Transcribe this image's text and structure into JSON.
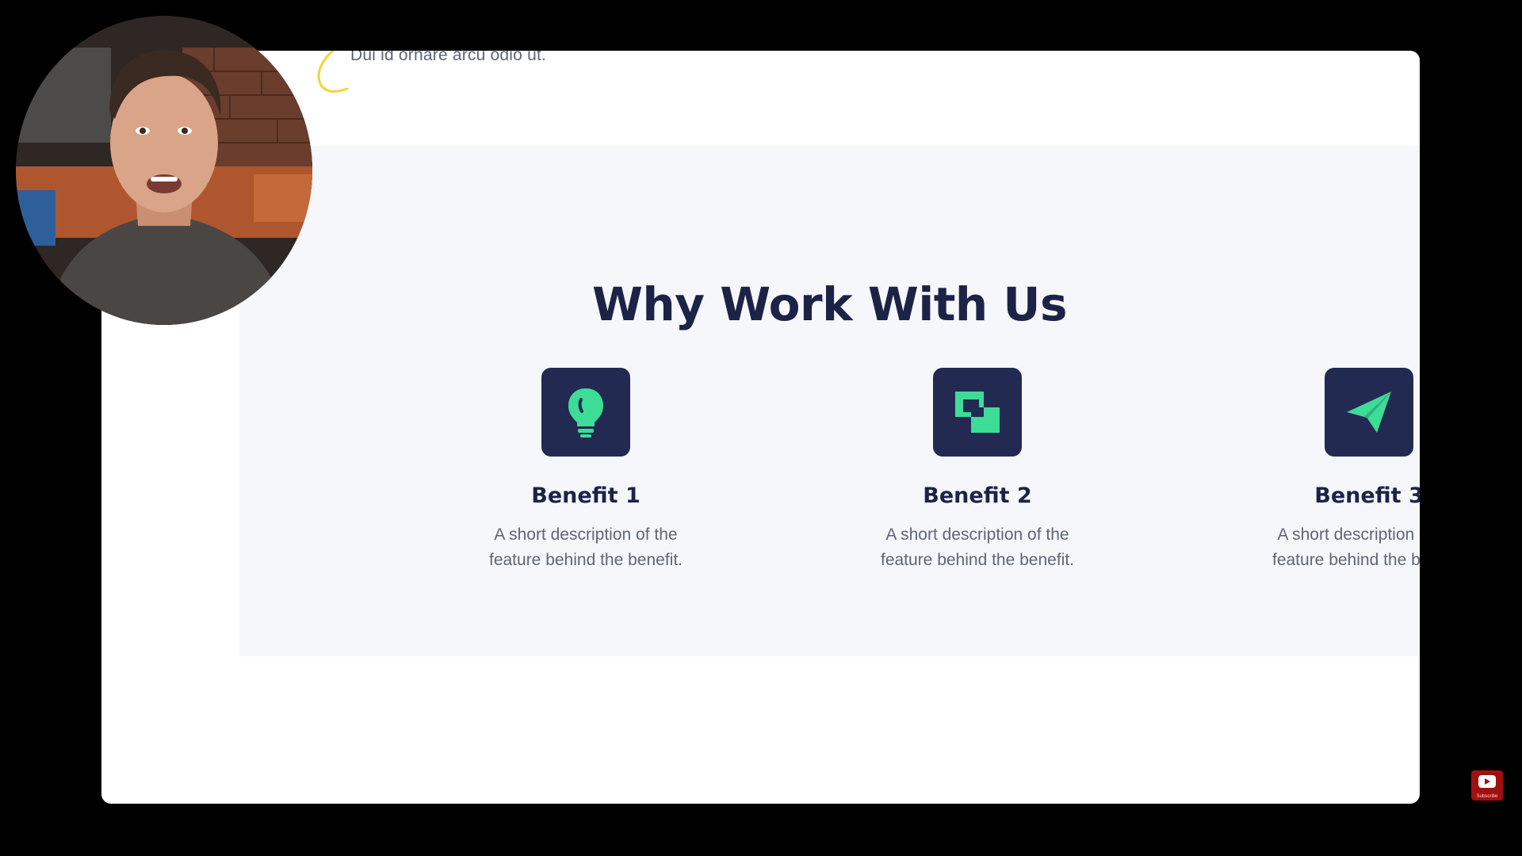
{
  "top_snippet": "Dui id ornare arcu odio ut.",
  "section": {
    "title": "Why Work With Us",
    "benefits": [
      {
        "icon": "lightbulb-icon",
        "title": "Benefit 1",
        "description": "A short description of the feature behind the benefit."
      },
      {
        "icon": "overlapping-squares-icon",
        "title": "Benefit 2",
        "description": "A short description of the feature behind the benefit."
      },
      {
        "icon": "paper-plane-icon",
        "title": "Benefit 3",
        "description": "A short description of the feature behind the benefit."
      }
    ]
  },
  "subscribe": {
    "label": "Subscribe",
    "icon": "youtube-icon"
  },
  "colors": {
    "icon_bg": "#222a52",
    "icon_accent": "#3ddc97",
    "heading": "#1c2346",
    "section_bg": "#f5f7fb"
  }
}
